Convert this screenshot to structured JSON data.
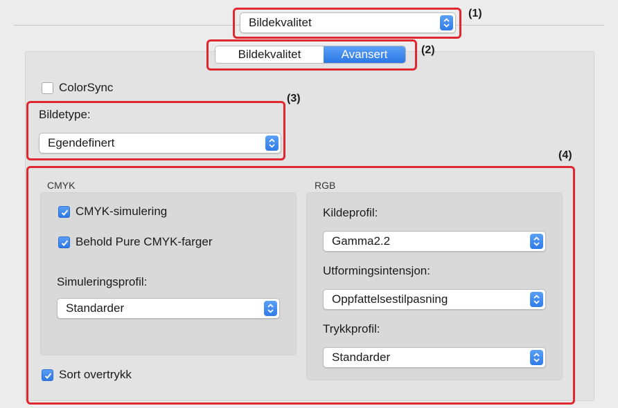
{
  "top_select": {
    "value": "Bildekvalitet"
  },
  "callouts": [
    "(1)",
    "(2)",
    "(3)",
    "(4)"
  ],
  "tabs": [
    {
      "label": "Bildekvalitet",
      "selected": false
    },
    {
      "label": "Avansert",
      "selected": true
    }
  ],
  "colorsync": {
    "label": "ColorSync",
    "checked": false
  },
  "bildetype": {
    "label": "Bildetype:",
    "value": "Egendefinert"
  },
  "cmyk": {
    "title": "CMYK",
    "simulation": {
      "label": "CMYK-simulering",
      "checked": true
    },
    "pure": {
      "label": "Behold Pure CMYK-farger",
      "checked": true
    },
    "profile_label": "Simuleringsprofil:",
    "profile_value": "Standarder"
  },
  "rgb": {
    "title": "RGB",
    "source_label": "Kildeprofil:",
    "source_value": "Gamma2.2",
    "intent_label": "Utformingsintensjon:",
    "intent_value": "Oppfattelsestilpasning",
    "print_label": "Trykkprofil:",
    "print_value": "Standarder"
  },
  "black_overprint": {
    "label": "Sort overtrykk",
    "checked": true
  },
  "colors": {
    "accent": "#2f7be8",
    "callout": "#e0262f"
  }
}
